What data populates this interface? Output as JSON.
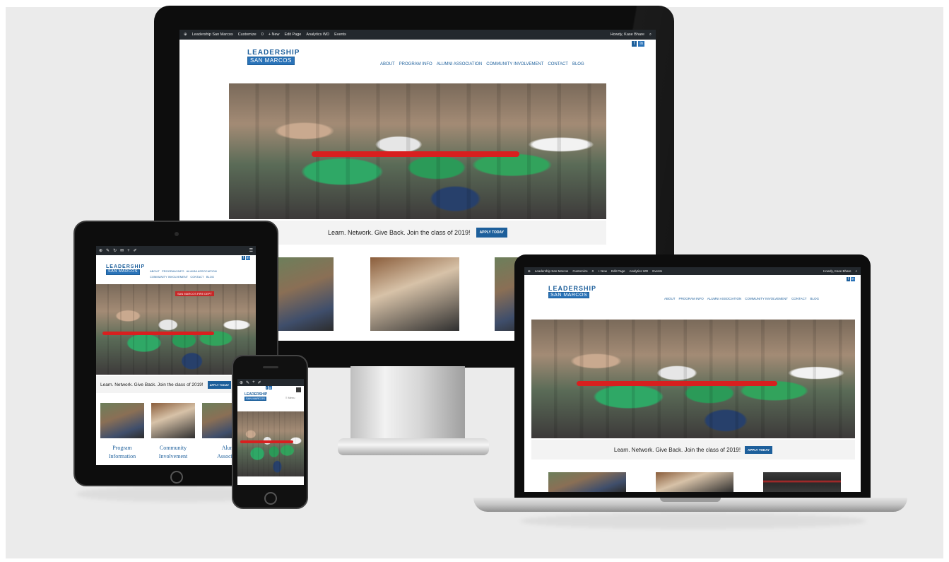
{
  "site": {
    "wp_bar": {
      "site_name": "Leadership San Marcos",
      "customize": "Customize",
      "comments": "0",
      "new": "+ New",
      "edit_page": "Edit Page",
      "analytics": "Analytics WD",
      "events": "Events",
      "howdy": "Howdy, Kase Bhare"
    },
    "logo": {
      "line1": "LEADERSHIP",
      "line2": "SAN MARCOS"
    },
    "nav": [
      "ABOUT",
      "PROGRAM INFO",
      "ALUMNI ASSOCIATION",
      "COMMUNITY INVOLVEMENT",
      "CONTACT",
      "BLOG"
    ],
    "social": {
      "facebook": "f",
      "linkedin": "in"
    },
    "cta": {
      "text": "Learn. Network. Give Back. Join the class of 2019!",
      "button": "APPLY TODAY"
    },
    "banner_sign": "SAN MARCOS FIRE DEPT",
    "cards": [
      {
        "title_1": "Program",
        "title_2": "Information"
      },
      {
        "title_1": "Community",
        "title_2": "Involvement"
      },
      {
        "title_1": "Alumni",
        "title_2": "Association"
      }
    ],
    "phone_menu": "Menu"
  },
  "colors": {
    "brand_blue": "#1d5f9b",
    "ribbon_red": "#d81f1f",
    "wp_bar": "#23282d",
    "background": "#ebebeb"
  }
}
